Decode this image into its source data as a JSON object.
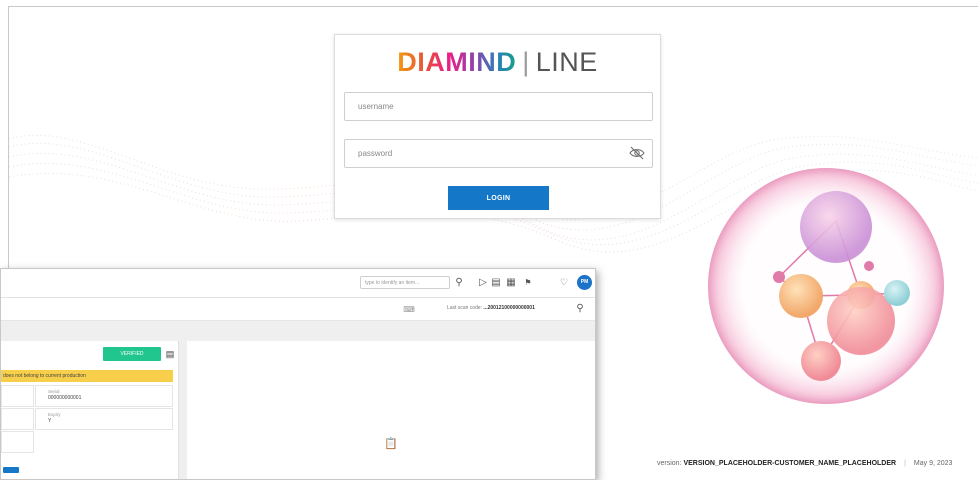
{
  "login": {
    "logo_bold": "DIAMIND",
    "logo_separator": "|",
    "logo_light": "LINE",
    "username_placeholder": "username",
    "password_placeholder": "password",
    "login_label": "LOGIN"
  },
  "footer": {
    "version_prefix": "version:",
    "version_value": "VERSION_PLACEHOLDER-CUSTOMER_NAME_PLACEHOLDER",
    "separator": "|",
    "date": "May 9, 2023"
  },
  "app": {
    "search_placeholder": "type to identify an item...",
    "avatar_initials": "PM",
    "last_scan_label": "Last scan code:",
    "last_scan_value": "...20012100000000001",
    "verified_label": "VERIFIED",
    "warning_text": "does not belong to current production",
    "serial_label": "Serial",
    "serial_value": "000000000001",
    "expiry_label": "Expiry",
    "expiry_value": "Y"
  },
  "colors": {
    "login_button": "#1477c7",
    "verified": "#21c58e",
    "warning": "#f7cf4b",
    "avatar": "#1a73c8"
  },
  "icons": [
    "eye-slash-icon",
    "search-icon",
    "play-icon",
    "database-icon",
    "grid-icon",
    "flag-us-icon",
    "bell-icon",
    "keyboard-icon",
    "clipboard-icon"
  ]
}
